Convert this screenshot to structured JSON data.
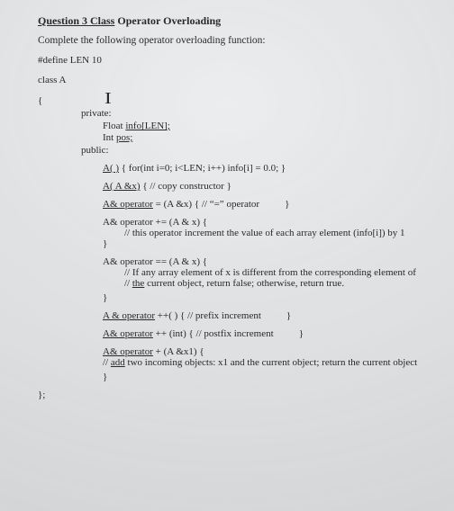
{
  "heading": {
    "prefix": "Question 3",
    "rest": " Class",
    "tail": " Operator Overloading"
  },
  "intro": "Complete the following operator overloading function:",
  "define": "#define LEN  10",
  "classline": "class A",
  "openbrace": "{",
  "cursor": "I",
  "private": "private:",
  "m_info": {
    "a": "Float ",
    "b": "info[LEN];"
  },
  "m_pos": {
    "a": "Int ",
    "b": "pos;"
  },
  "public": "public:",
  "ctor": {
    "sig": "A( )",
    "body": " {   for(int i=0; i<LEN; i++)   info[i] = 0.0;  }"
  },
  "copy": {
    "sig": "A( A &x)",
    "body": "  {    // copy constructor   }"
  },
  "assign": {
    "sig": "A&  operator",
    "mid": " = (A &x)  {    // “=” operator",
    "tail": "}"
  },
  "pluseq": {
    "sig": "A& operator += (A & x) {",
    "c": "// this operator increment the value of each array element (info[i]) by 1",
    "close": "}"
  },
  "eqeq": {
    "sig": "A& operator == (A & x) {",
    "c1": "// If any array element of x is different from the corresponding element of",
    "c2a": "// ",
    "c2b": "the",
    "c2c": " current object, return false; otherwise, return true.",
    "close": "}"
  },
  "pre": {
    "sig": "A &  operator",
    "mid": " ++( )  {    // prefix increment",
    "tail": "}"
  },
  "post": {
    "sig": "A&  operator",
    "mid": " ++ (int)  {    // postfix increment",
    "tail": "}"
  },
  "plus": {
    "sig": "A&  operator",
    "mid": " + (A &x1) {",
    "c1a": "// ",
    "c1b": "add",
    "c1c": " two incoming objects: x1 and the current object; return the current object",
    "close": "}"
  },
  "closebrace": "};"
}
